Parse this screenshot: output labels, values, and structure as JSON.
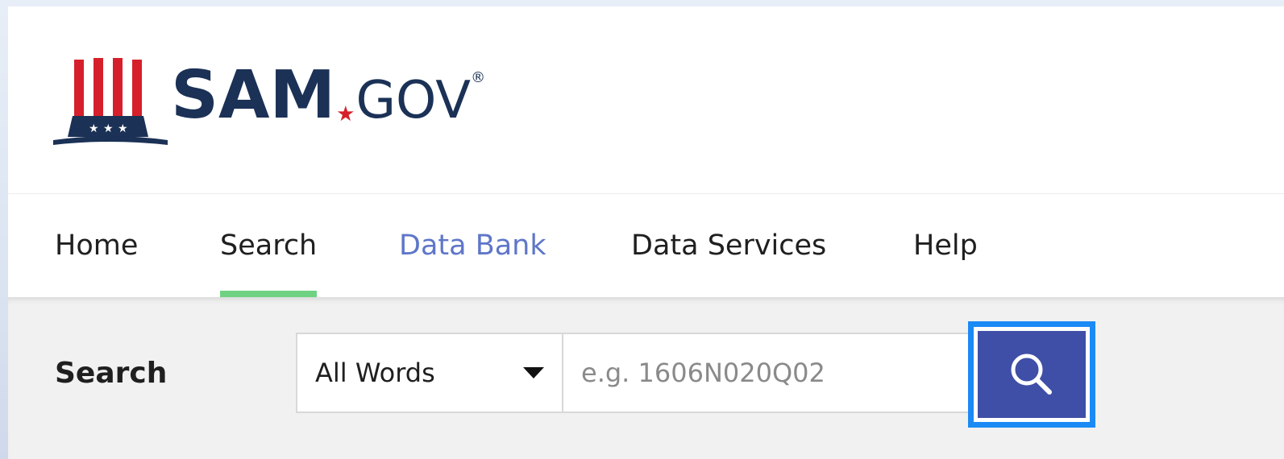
{
  "logo": {
    "sam_text": "SAM",
    "star_glyph": "★",
    "gov_text": "GOV",
    "registered_mark": "®",
    "brand_navy": "#1b3156",
    "brand_red": "#d5202b"
  },
  "nav": {
    "items": [
      {
        "label": "Home"
      },
      {
        "label": "Search",
        "active": true
      },
      {
        "label": "Data Bank"
      },
      {
        "label": "Data Services"
      },
      {
        "label": "Help"
      }
    ],
    "active_indicator_color": "#6fd282",
    "link_color": "#5f76c9"
  },
  "search": {
    "heading": "Search",
    "type_selected": "All Words",
    "placeholder": "e.g. 1606N020Q02",
    "value": "",
    "button_icon": "search-icon",
    "button_color": "#3f4fa7",
    "focus_ring_color": "#1b8af5"
  }
}
